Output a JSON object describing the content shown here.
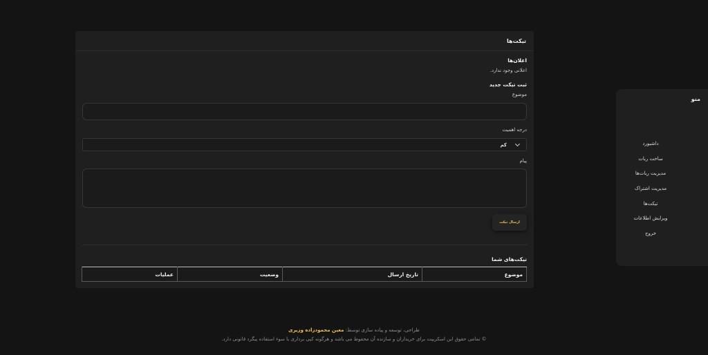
{
  "card": {
    "title": "تیکت‌ها",
    "announcements_title": "اعلان‌ها",
    "announcements_empty": "اعلانی وجود ندارد.",
    "new_ticket_title": "ثبت تیکت جدید",
    "subject_label": "موضوع",
    "subject_value": "",
    "priority_label": "درجه اهمیت",
    "priority_selected": "کم",
    "message_label": "پیام",
    "message_value": "",
    "send_button": "ارسال تیکت",
    "your_tickets_title": "تیکت‌های شما",
    "table_headers": [
      "موضوع",
      "تاریخ ارسال",
      "وضعیت",
      "عملیات"
    ]
  },
  "sidebar": {
    "title": "منو",
    "items": [
      "داشبورد",
      "ساخت ربات",
      "مدیریت ربات‌ها",
      "مدیریت اشتراک",
      "تیکت‌ها",
      "ویرایش اطلاعات",
      "خروج"
    ]
  },
  "footer": {
    "credit_prefix": "طراحی، توسعه و پیاده سازی توسط:",
    "author": "معین محمودزاده وزیری",
    "copyright": "© تمامی حقوق این اسکریپت برای خریداران و سازنده آن محفوظ می باشد و هرگونه کپی برداری یا سوء استفاده پیگرد قانونی دارد."
  },
  "colors": {
    "background": "#141414",
    "panel": "#1f1f1f",
    "accent": "#f2c14e"
  }
}
